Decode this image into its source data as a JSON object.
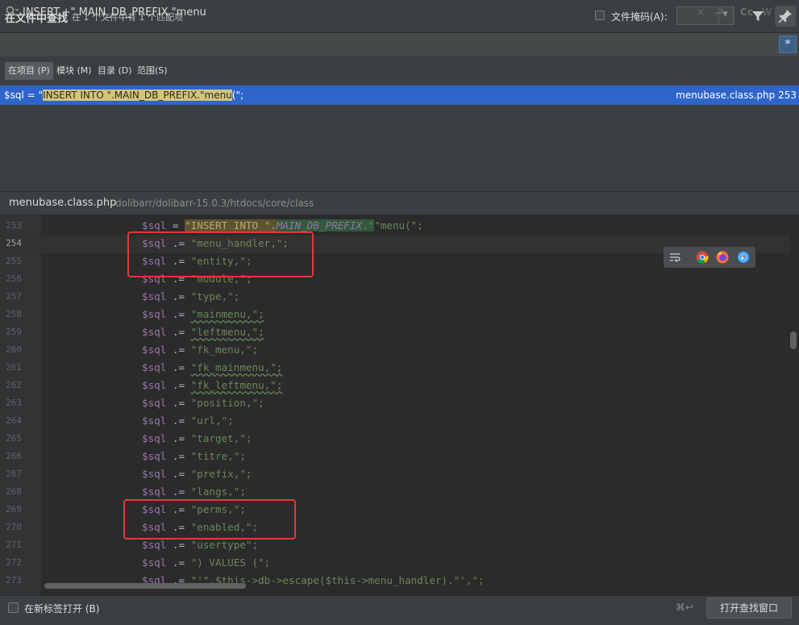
{
  "header": {
    "title": "在文件中查找",
    "subtitle": "在 1 个文件中有 1 个匹配项",
    "file_mask_label": "文件掩码(A):",
    "file_mask_value": ""
  },
  "search": {
    "query": "INSERT.+\".MAIN_DB_PREFIX.\"menu",
    "opt_case": "Cc",
    "opt_word": "W",
    "opt_regex": "*"
  },
  "scopes": {
    "project": "在项目 (P)",
    "module": "模块 (M)",
    "directory": "目录 (D)",
    "scope": "范围(S)"
  },
  "results": [
    {
      "pre": "$sql = \"",
      "match": "INSERT INTO \".MAIN_DB_PREFIX.\"menu",
      "post": "(\";",
      "file": "menubase.class.php 253"
    }
  ],
  "preview": {
    "file_name": "menubase.class.php",
    "file_dir": "dolibarr/dolibarr-15.0.3/htdocs/core/class"
  },
  "code": {
    "lines": [
      {
        "n": "253",
        "v": "$sql",
        "o": " = ",
        "s": "\"menu(\";",
        "special": "first"
      },
      {
        "n": "254",
        "v": "$sql",
        "o": " .= ",
        "s": "\"menu_handler,\";"
      },
      {
        "n": "255",
        "v": "$sql",
        "o": " .= ",
        "s": "\"entity,\";"
      },
      {
        "n": "256",
        "v": "$sql",
        "o": " .= ",
        "s": "\"module,\";"
      },
      {
        "n": "257",
        "v": "$sql",
        "o": " .= ",
        "s": "\"type,\";"
      },
      {
        "n": "258",
        "v": "$sql",
        "o": " .= ",
        "s": "\"mainmenu,\";"
      },
      {
        "n": "259",
        "v": "$sql",
        "o": " .= ",
        "s": "\"leftmenu,\";"
      },
      {
        "n": "260",
        "v": "$sql",
        "o": " .= ",
        "s": "\"fk_menu,\";"
      },
      {
        "n": "261",
        "v": "$sql",
        "o": " .= ",
        "s": "\"fk_mainmenu,\";"
      },
      {
        "n": "262",
        "v": "$sql",
        "o": " .= ",
        "s": "\"fk_leftmenu,\";"
      },
      {
        "n": "263",
        "v": "$sql",
        "o": " .= ",
        "s": "\"position,\";"
      },
      {
        "n": "264",
        "v": "$sql",
        "o": " .= ",
        "s": "\"url,\";"
      },
      {
        "n": "265",
        "v": "$sql",
        "o": " .= ",
        "s": "\"target,\";"
      },
      {
        "n": "266",
        "v": "$sql",
        "o": " .= ",
        "s": "\"titre,\";"
      },
      {
        "n": "267",
        "v": "$sql",
        "o": " .= ",
        "s": "\"prefix,\";"
      },
      {
        "n": "268",
        "v": "$sql",
        "o": " .= ",
        "s": "\"langs,\";"
      },
      {
        "n": "269",
        "v": "$sql",
        "o": " .= ",
        "s": "\"perms,\";"
      },
      {
        "n": "270",
        "v": "$sql",
        "o": " .= ",
        "s": "\"enabled,\";"
      },
      {
        "n": "271",
        "v": "$sql",
        "o": " .= ",
        "s": "\"usertype\";"
      },
      {
        "n": "272",
        "v": "$sql",
        "o": " .= ",
        "s": "\") VALUES (\";"
      },
      {
        "n": "273",
        "v": "$sql",
        "o": " .= ",
        "s": "\"'\".$this->db->escape($this->menu_handler).\"',\";"
      }
    ],
    "line253_string1": "\"INSERT INTO \".",
    "line253_const": "MAIN_DB_PREFIX",
    "line253_string2": ".\"",
    "current_line": "254"
  },
  "footer": {
    "open_new_tab_label": "在新标签打开 (B)",
    "shortcut": "⌘↩",
    "open_find_window_label": "打开查找窗口"
  },
  "colors": {
    "selection": "#2f65ca",
    "annotation": "#e03a3a",
    "editor_bg": "#2b2b2b"
  }
}
